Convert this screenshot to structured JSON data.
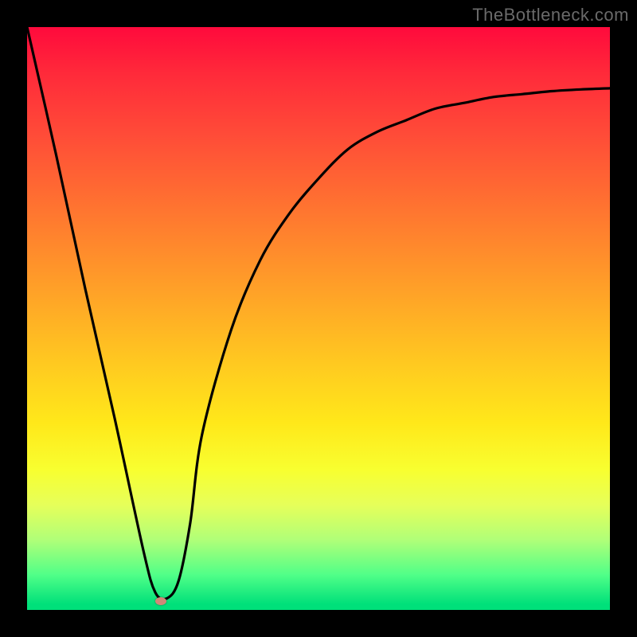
{
  "watermark": "TheBottleneck.com",
  "chart_data": {
    "type": "line",
    "title": "",
    "xlabel": "",
    "ylabel": "",
    "xlim": [
      0,
      100
    ],
    "ylim": [
      0,
      100
    ],
    "series": [
      {
        "name": "curve",
        "x": [
          0,
          5,
          10,
          15,
          20,
          22,
          24,
          26,
          28,
          30,
          35,
          40,
          45,
          50,
          55,
          60,
          65,
          70,
          75,
          80,
          85,
          90,
          95,
          100
        ],
        "y": [
          100,
          78,
          55,
          33,
          10,
          3,
          2,
          5,
          15,
          30,
          48,
          60,
          68,
          74,
          79,
          82,
          84,
          86,
          87,
          88,
          88.5,
          89,
          89.3,
          89.5
        ]
      }
    ],
    "marker": {
      "x": 23,
      "y": 1.5
    },
    "gradient_stops": [
      {
        "pos": 0,
        "color": "#ff0a3c"
      },
      {
        "pos": 50,
        "color": "#ffd020"
      },
      {
        "pos": 80,
        "color": "#f8ff30"
      },
      {
        "pos": 99,
        "color": "#00e07a"
      }
    ]
  }
}
